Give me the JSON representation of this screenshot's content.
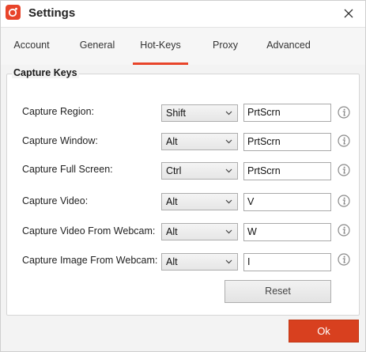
{
  "window": {
    "title": "Settings"
  },
  "tabs": [
    {
      "label": "Account",
      "active": false
    },
    {
      "label": "General",
      "active": false
    },
    {
      "label": "Hot-Keys",
      "active": true
    },
    {
      "label": "Proxy",
      "active": false
    },
    {
      "label": "Advanced",
      "active": false
    }
  ],
  "capture_keys": {
    "title": "Capture Keys",
    "rows": [
      {
        "label": "Capture Region:",
        "modifier": "Shift",
        "key": "PrtScrn"
      },
      {
        "label": "Capture Window:",
        "modifier": "Alt",
        "key": "PrtScrn"
      },
      {
        "label": "Capture Full Screen:",
        "modifier": "Ctrl",
        "key": "PrtScrn"
      },
      {
        "label": "Capture Video:",
        "modifier": "Alt",
        "key": "V"
      },
      {
        "label": "Capture Video From Webcam:",
        "modifier": "Alt",
        "key": "W"
      },
      {
        "label": "Capture Image From Webcam:",
        "modifier": "Alt",
        "key": "I"
      }
    ],
    "reset_label": "Reset"
  },
  "footer": {
    "ok_label": "Ok"
  },
  "colors": {
    "accent": "#e8442a",
    "ok_button": "#d8401f"
  },
  "icons": {
    "app": "camera-icon",
    "close": "close-icon",
    "dropdown": "chevron-down-icon",
    "info": "info-icon"
  }
}
